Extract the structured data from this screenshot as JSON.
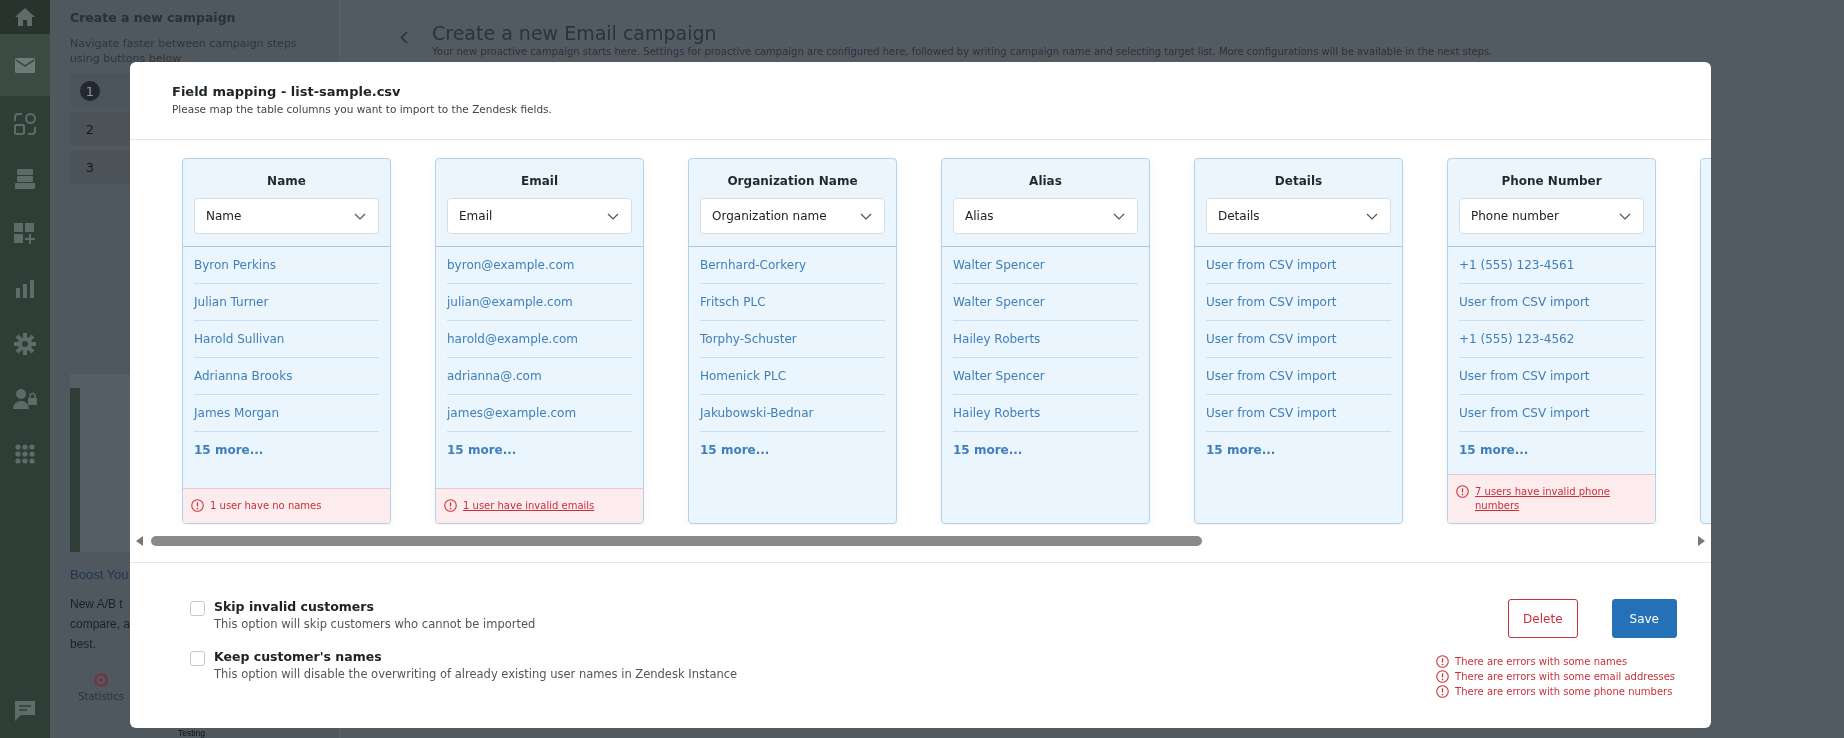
{
  "sidebar": {
    "items": [
      {
        "kind": "home",
        "selected": false
      },
      {
        "kind": "mail",
        "selected": true
      },
      {
        "kind": "shapes",
        "selected": false
      },
      {
        "kind": "stack",
        "selected": false
      },
      {
        "kind": "grid-plus",
        "selected": false
      },
      {
        "kind": "chart",
        "selected": false
      },
      {
        "kind": "gear",
        "selected": false
      },
      {
        "kind": "user-lock",
        "selected": false
      },
      {
        "kind": "apps",
        "selected": false
      }
    ],
    "bottom_item": {
      "kind": "chat"
    }
  },
  "steps_panel": {
    "title": "Create a new campaign",
    "description": "Navigate faster between campaign steps using buttons below",
    "steps": [
      {
        "number": "1",
        "selected": true
      },
      {
        "number": "2",
        "selected": false
      },
      {
        "number": "3",
        "selected": false
      }
    ],
    "promo": {
      "title": "Boost You",
      "lines": [
        "New A/B t",
        "compare, a",
        "best."
      ],
      "tile_label": "Statistics",
      "second_tile_label": "Testing"
    }
  },
  "page_header": {
    "title": "Create a new Email campaign",
    "subtitle": "Your new proactive campaign starts here. Settings for proactive campaign are configured here, followed by writing campaign name and selecting target list. More configurations will be available in the next steps."
  },
  "modal": {
    "title": "Field mapping - list-sample.csv",
    "description": "Please map the table columns you want to import to the Zendesk fields.",
    "columns": [
      {
        "header": "Name",
        "mapping": "Name",
        "rows": [
          "Byron Perkins",
          "Julian Turner",
          "Harold Sullivan",
          "Adrianna Brooks",
          "James Morgan"
        ],
        "more": "15 more...",
        "error": {
          "kind": "text",
          "text": "1 user have no names"
        }
      },
      {
        "header": "Email",
        "mapping": "Email",
        "rows": [
          "byron@example.com",
          "julian@example.com",
          "harold@example.com",
          "adrianna@.com",
          "james@example.com"
        ],
        "more": "15 more...",
        "error": {
          "kind": "link",
          "text": "1 user have invalid emails"
        }
      },
      {
        "header": "Organization Name",
        "mapping": "Organization name",
        "rows": [
          "Bernhard-Corkery",
          "Fritsch PLC",
          "Torphy-Schuster",
          "Homenick PLC",
          "Jakubowski-Bednar"
        ],
        "more": "15 more..."
      },
      {
        "header": "Alias",
        "mapping": "Alias",
        "rows": [
          "Walter Spencer",
          "Walter Spencer",
          "Hailey Roberts",
          "Walter Spencer",
          "Hailey Roberts"
        ],
        "more": "15 more..."
      },
      {
        "header": "Details",
        "mapping": "Details",
        "rows": [
          "User from CSV import",
          "User from CSV import",
          "User from CSV import",
          "User from CSV import",
          "User from CSV import"
        ],
        "more": "15 more..."
      },
      {
        "header": "Phone Number",
        "mapping": "Phone number",
        "rows": [
          "+1 (555) 123-4561",
          "User from CSV import",
          "+1 (555) 123-4562",
          "User from CSV import",
          "User from CSV import"
        ],
        "more": "15 more...",
        "error": {
          "kind": "link",
          "text": "7 users have invalid phone numbers"
        }
      }
    ],
    "options": [
      {
        "label": "Skip invalid customers",
        "description": "This option will skip customers who cannot be imported",
        "checked": false
      },
      {
        "label": "Keep customer's names",
        "description": "This option will disable the overwriting of already existing user names in Zendesk Instance",
        "checked": false
      }
    ],
    "buttons": {
      "delete": "Delete",
      "save": "Save"
    },
    "errors": [
      "There are errors with some names",
      "There are errors with some email addresses",
      "There are errors with some phone numbers"
    ]
  }
}
